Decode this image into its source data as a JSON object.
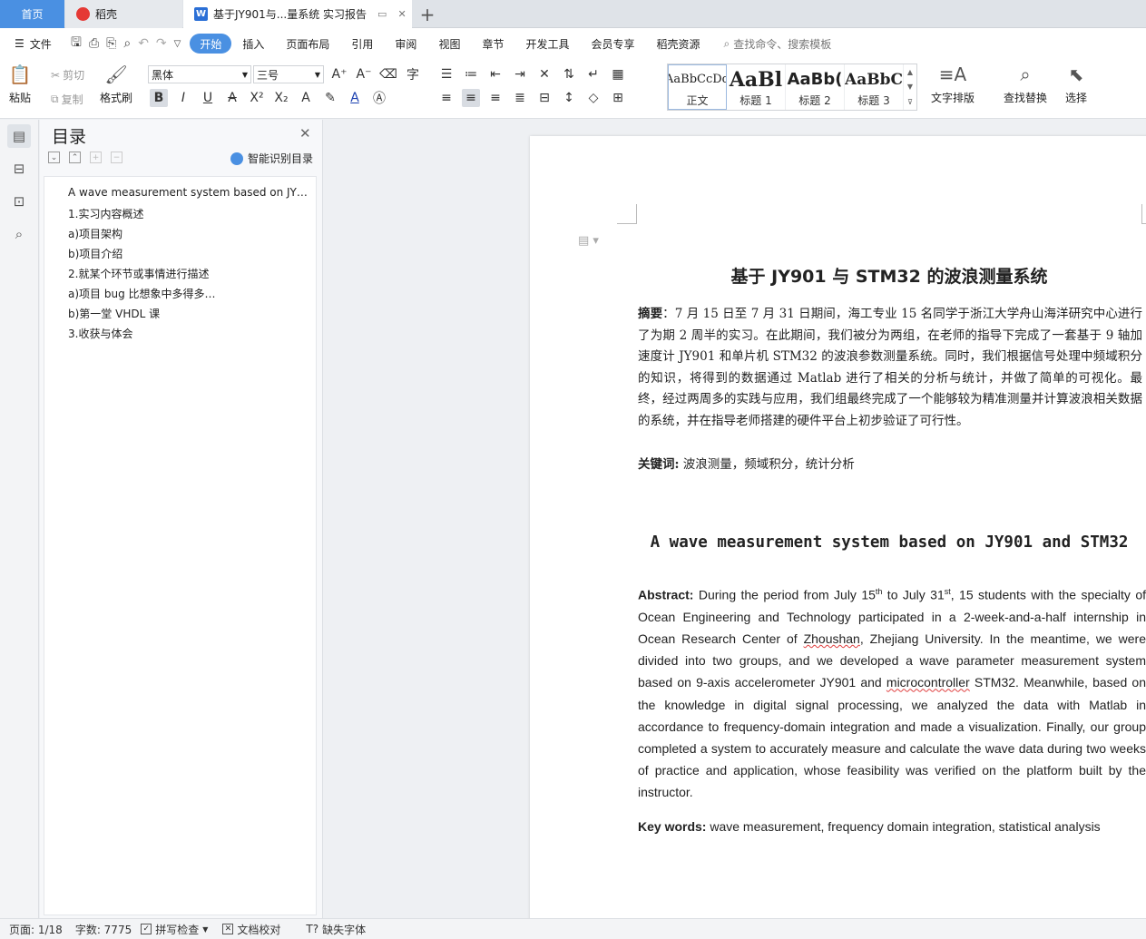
{
  "tabs": {
    "home": "首页",
    "daoke": "稻壳",
    "doc": "基于JY901与...量系统 实习报告"
  },
  "menu": {
    "file": "文件",
    "items": [
      "开始",
      "插入",
      "页面布局",
      "引用",
      "审阅",
      "视图",
      "章节",
      "开发工具",
      "会员专享",
      "稻壳资源"
    ],
    "search": "查找命令、搜索模板"
  },
  "ribbon": {
    "paste": "粘贴",
    "cut": "剪切",
    "copy": "复制",
    "format_painter": "格式刷",
    "font_name": "黑体",
    "font_size": "三号",
    "text_layout": "文字排版",
    "find_replace": "查找替换",
    "select": "选择",
    "styles": [
      {
        "sample": "AaBbCcDd",
        "label": "正文"
      },
      {
        "sample": "AaBl",
        "label": "标题 1"
      },
      {
        "sample": "AaBb(",
        "label": "标题 2"
      },
      {
        "sample": "AaBbC",
        "label": "标题 3"
      }
    ]
  },
  "toc": {
    "title": "目录",
    "smart": "智能识别目录",
    "items": [
      "A wave measurement system based on JY901 and STM32",
      "1.实习内容概述",
      "a)项目架构",
      "b)项目介绍",
      "2.就某个环节或事情进行描述",
      "a)项目 bug 比想象中多得多…",
      "b)第一堂 VHDL 课",
      "3.收获与体会"
    ]
  },
  "document": {
    "title": "基于 JY901 与 STM32 的波浪测量系统",
    "abstract_label": "摘要",
    "abstract_text": "：7 月 15 日至 7 月 31 日期间，海工专业 15 名同学于浙江大学舟山海洋研究中心进行了为期 2 周半的实习。在此期间，我们被分为两组，在老师的指导下完成了一套基于 9 轴加速度计 JY901 和单片机 STM32 的波浪参数测量系统。同时，我们根据信号处理中频域积分的知识，将得到的数据通过 Matlab 进行了相关的分析与统计，并做了简单的可视化。最终，经过两周多的实践与应用，我们组最终完成了一个能够较为精准测量并计算波浪相关数据的系统，并在指导老师搭建的硬件平台上初步验证了可行性。",
    "keywords_label": "关键词:",
    "keywords": " 波浪测量，频域积分，统计分析",
    "en_title": "A wave measurement system based on JY901 and STM32",
    "en_abstract_label": "Abstract:",
    "en_abs_1": " During the period from July 15",
    "en_sup_1": "th",
    "en_abs_2": " to July 31",
    "en_sup_2": "st",
    "en_abs_3": ", 15 students with the specialty of Ocean Engineering and Technology participated in a 2-week-and-a-half internship in Ocean Research Center of ",
    "en_sq_1": "Zhoushan",
    "en_abs_4": ", Zhejiang University. In the meantime, we were divided into two groups, and we developed a wave parameter measurement system based on 9-axis accelerometer JY901 and ",
    "en_sq_2": "microcontroller",
    "en_abs_5": " STM32. Meanwhile, based on the knowledge in digital signal processing, we analyzed the data with Matlab in accordance to frequency-domain integration and made a visualization. Finally, our group completed a system to accurately measure and calculate the wave data during two weeks of practice and application, whose feasibility was verified on the platform built by the instructor.",
    "en_kw_label": "Key words:",
    "en_kw": " wave measurement, frequency domain integration, statistical analysis"
  },
  "status": {
    "page": "页面: 1/18",
    "words": "字数: 7775",
    "spell": "拼写检查",
    "proof": "文档校对",
    "missing_font": "缺失字体"
  },
  "colors": {
    "accent": "#4a90e2",
    "squiggle": "#e04040"
  }
}
